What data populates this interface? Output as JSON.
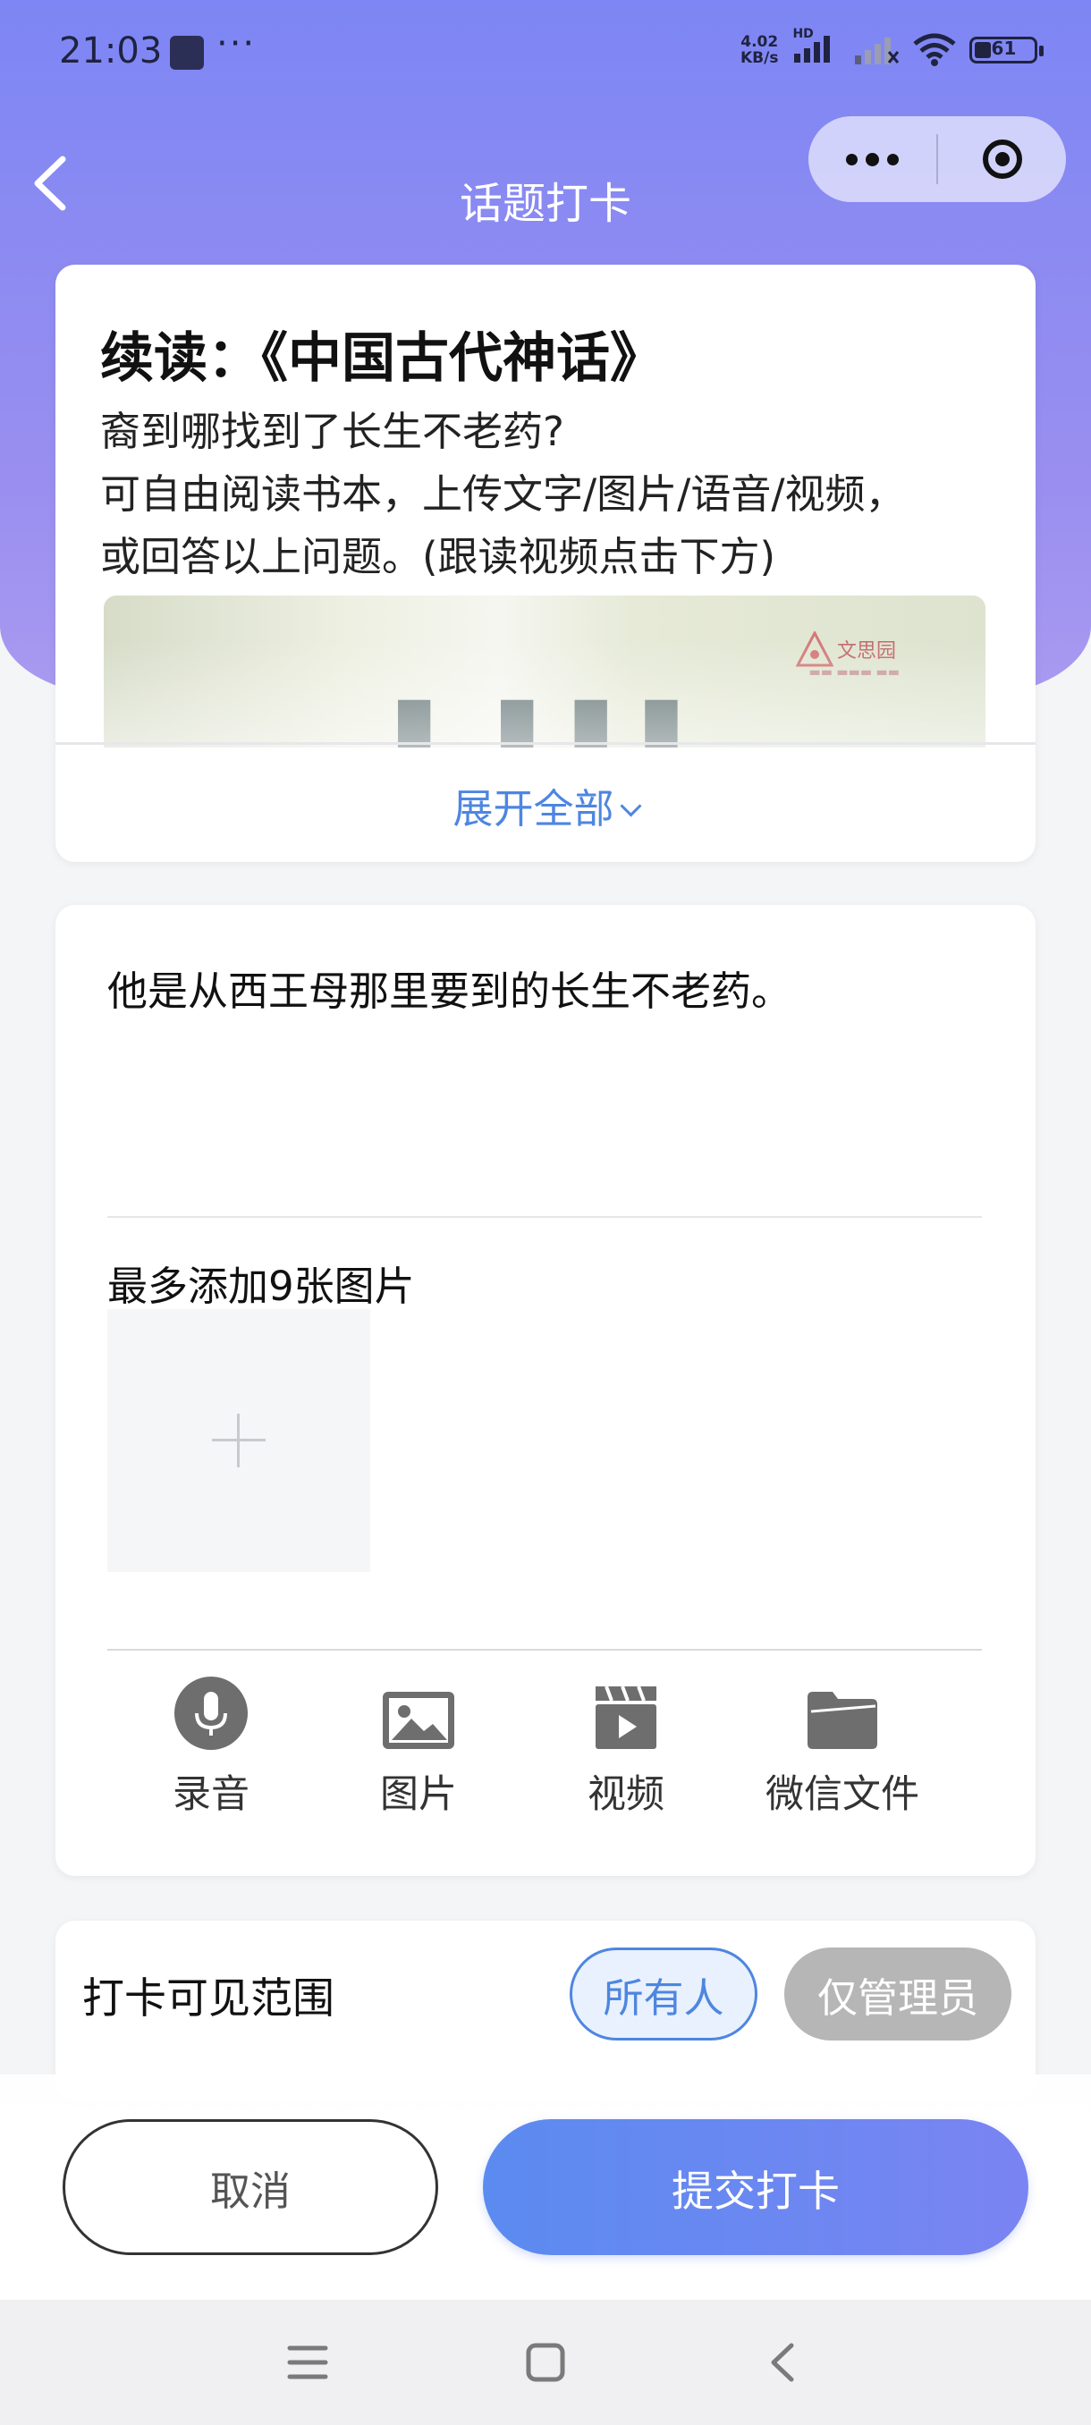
{
  "status_bar": {
    "time": "21:03",
    "more_dots": "···",
    "net_speed_value": "4.02",
    "net_speed_unit": "KB/s",
    "network_type": "HD",
    "battery": "61"
  },
  "nav": {
    "title": "话题打卡"
  },
  "topic": {
    "title": "续读：《中国古代神话》",
    "description": [
      "裔到哪找到了长生不老药?",
      "可自由阅读书本，上传文字/图片/语音/视频，",
      "或回答以上问题。(跟读视频点击下方)"
    ],
    "image_brand": "文思园",
    "expand_label": "展开全部"
  },
  "post": {
    "text": "他是从西王母那里要到的长生不老药。",
    "image_hint": "最多添加9张图片",
    "tools": [
      {
        "label": "录音",
        "icon": "microphone-icon"
      },
      {
        "label": "图片",
        "icon": "image-icon"
      },
      {
        "label": "视频",
        "icon": "video-icon"
      },
      {
        "label": "微信文件",
        "icon": "folder-icon"
      }
    ]
  },
  "visibility": {
    "label": "打卡可见范围",
    "options": [
      "所有人",
      "仅管理员"
    ],
    "selected": "所有人"
  },
  "actions": {
    "cancel": "取消",
    "submit": "提交打卡"
  },
  "colors": {
    "accent": "#4e86e0",
    "header_gradient_start": "#7d86f4",
    "header_gradient_end": "#a99af0",
    "submit_gradient_start": "#5b8bf0",
    "submit_gradient_end": "#7a84f2"
  }
}
